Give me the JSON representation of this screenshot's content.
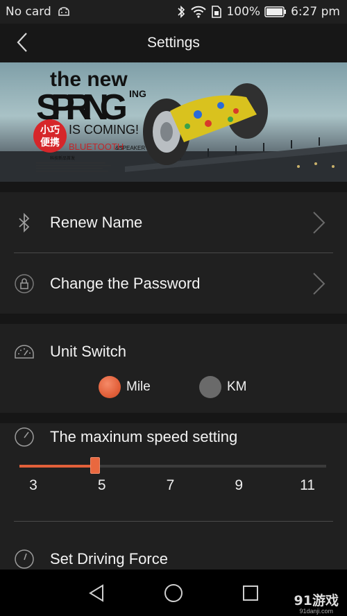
{
  "status_bar": {
    "carrier": "No card",
    "battery": "100%",
    "time": "6:27 pm"
  },
  "header": {
    "title": "Settings"
  },
  "banner": {
    "line1": "the new",
    "line2": "SPRING",
    "line2_suffix": "ING",
    "line3": "IS COMING!",
    "badge_top": "小巧",
    "badge_bottom": "便携",
    "bluetooth": "BLUETOOTH",
    "speaker": "&SPEAKER",
    "cn_subtitle": "科技新品首发"
  },
  "menu": {
    "renew_name": "Renew Name",
    "change_password": "Change the Password"
  },
  "unit_switch": {
    "label": "Unit Switch",
    "options": [
      {
        "label": "Mile",
        "selected": true
      },
      {
        "label": "KM",
        "selected": false
      }
    ]
  },
  "max_speed": {
    "label": "The maxinum speed setting",
    "min": 3,
    "max": 11,
    "value": 4.8,
    "ticks": [
      "3",
      "5",
      "7",
      "9",
      "11"
    ]
  },
  "driving_force": {
    "label": "Set Driving Force"
  },
  "watermark": {
    "main": "91游戏",
    "sub": "91danji.com"
  },
  "colors": {
    "accent": "#e2603a",
    "radio_off": "#6a6a6a",
    "background": "#161616",
    "card": "#202020"
  }
}
